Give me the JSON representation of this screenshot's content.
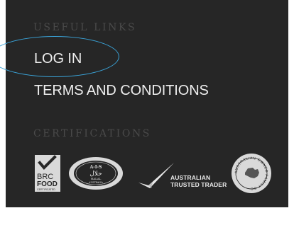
{
  "useful_links": {
    "title": "USEFUL LINKS",
    "links": [
      {
        "label": "LOG IN"
      },
      {
        "label": "TERMS AND CONDITIONS"
      }
    ]
  },
  "certifications": {
    "title": "CERTIFICATIONS",
    "brc": {
      "line1": "BRC",
      "line2": "FOOD",
      "line3": "CERTIFICATED"
    },
    "halal": {
      "top": "A-I-S",
      "arabic": "حلال",
      "line1": "HALAL",
      "line2": "AUSTRALIA"
    },
    "trader": {
      "line1": "AUSTRALIAN",
      "line2": "TRUSTED TRADER"
    },
    "seal": {
      "text": "AUSTRALIAN OWNED FAMILY CO"
    }
  },
  "colors": {
    "background": "#262626",
    "section_title": "#4a4a4a",
    "link": "#eeeeee",
    "highlight_ring": "#3aa3d8"
  }
}
